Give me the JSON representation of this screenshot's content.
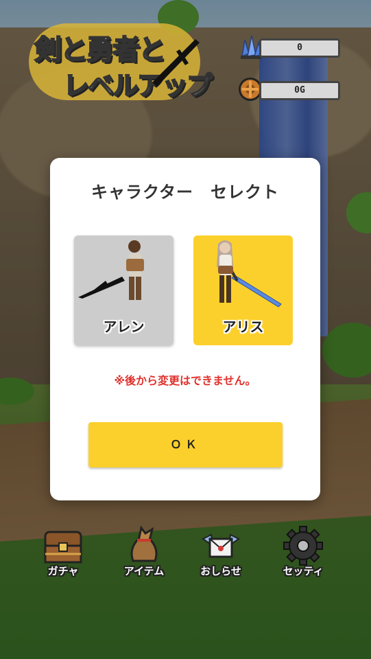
{
  "logo": {
    "line1": "剣と勇者と",
    "line2": "レベルアップ"
  },
  "resources": {
    "crystal_value": "0",
    "gold_value": "0G",
    "crystal_icon": "crystal-icon",
    "gold_icon": "gear-coin-icon"
  },
  "dialog": {
    "title": "キャラクター　セレクト",
    "characters": [
      {
        "name": "アレン",
        "selected": false,
        "bg": "#cccccc"
      },
      {
        "name": "アリス",
        "selected": true,
        "bg": "#fcd02c"
      }
    ],
    "warning": "※後から変更はできません。",
    "ok_label": "ＯＫ"
  },
  "menu": {
    "items": [
      {
        "label": "ガチャ",
        "icon": "treasure-chest-icon"
      },
      {
        "label": "アイテム",
        "icon": "item-bag-icon"
      },
      {
        "label": "おしらせ",
        "icon": "winged-letter-icon"
      },
      {
        "label": "セッティ",
        "icon": "gear-icon"
      }
    ]
  },
  "colors": {
    "accent": "#fcd02c",
    "warning": "#e0312c",
    "card_gray": "#cccccc"
  }
}
